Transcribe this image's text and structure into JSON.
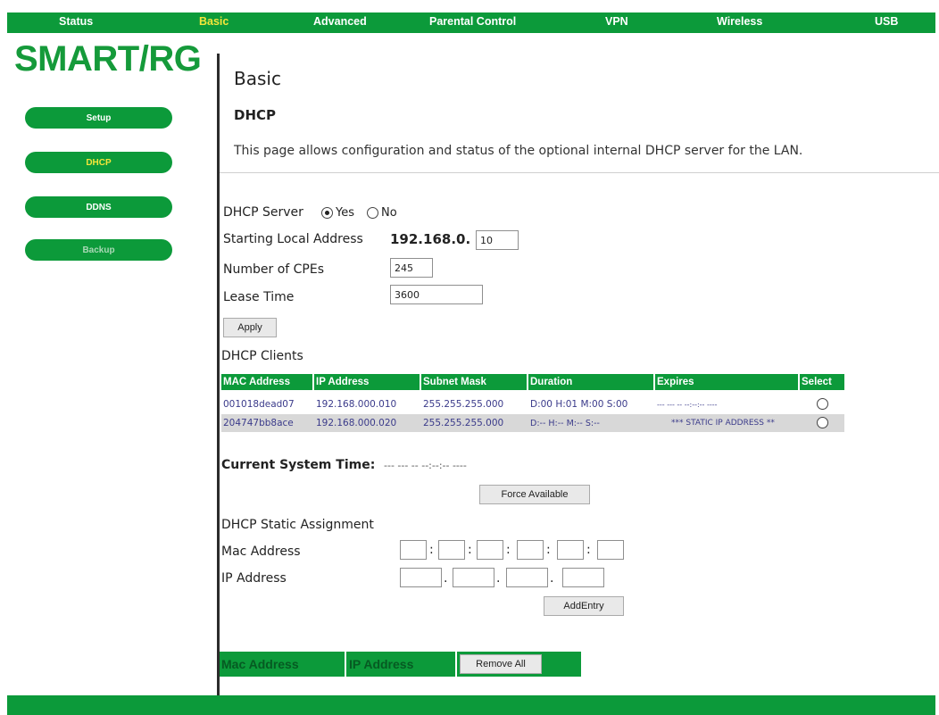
{
  "nav": [
    "Status",
    "Basic",
    "Advanced",
    "Parental Control",
    "VPN",
    "Wireless",
    "USB"
  ],
  "logo": "SMART/RG",
  "sidebar": [
    "Setup",
    "DHCP",
    "DDNS",
    "Backup"
  ],
  "page": {
    "title": "Basic",
    "section": "DHCP",
    "description": "This page allows configuration and status of the optional internal DHCP server for the LAN."
  },
  "form": {
    "server_label": "DHCP Server",
    "yes_label": "Yes",
    "no_label": "No",
    "start_label": "Starting Local Address",
    "start_prefix": "192.168.0.",
    "start_value": "10",
    "cpes_label": "Number of CPEs",
    "cpes_value": "245",
    "lease_label": "Lease Time",
    "lease_value": "3600",
    "apply_label": "Apply"
  },
  "clients": {
    "title": "DHCP Clients",
    "headers": [
      "MAC Address",
      "IP Address",
      "Subnet Mask",
      "Duration",
      "Expires",
      "Select"
    ],
    "rows": [
      [
        "001018dead07",
        "192.168.000.010",
        "255.255.255.000",
        "D:00 H:01 M:00 S:00",
        "--- --- -- --:--:-- ----"
      ],
      [
        "204747bb8ace",
        "192.168.000.020",
        "255.255.255.000",
        "D:-- H:-- M:-- S:--",
        "*** STATIC IP ADDRESS **"
      ]
    ]
  },
  "time": {
    "label": "Current System Time:",
    "value": "--- --- -- --:--:-- ----",
    "force_label": "Force Available"
  },
  "static": {
    "title": "DHCP Static Assignment",
    "mac_label": "Mac Address",
    "ip_label": "IP Address",
    "add_label": "AddEntry"
  },
  "bottom": {
    "mac": "Mac Address",
    "ip": "IP Address",
    "remove": "Remove All"
  },
  "colors": {
    "brand_green": "#0c9a3a",
    "active_yellow": "#f5e63a"
  }
}
